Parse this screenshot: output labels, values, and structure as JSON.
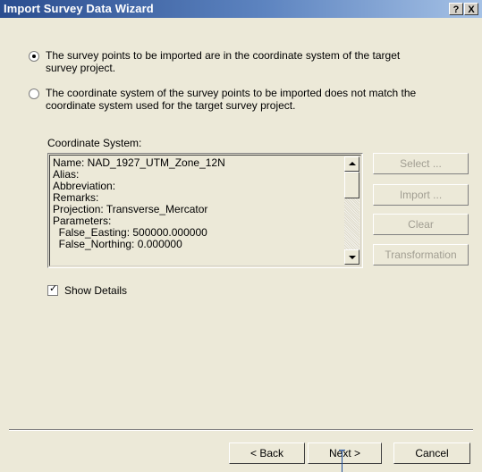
{
  "window": {
    "title": "Import Survey Data Wizard",
    "help_label": "?",
    "close_label": "X"
  },
  "options": {
    "same_system": {
      "line1": "The survey points to be imported are in the coordinate system of the target",
      "line2": "survey project.",
      "checked": true
    },
    "different_system": {
      "line1": "The coordinate system of the survey points to be imported does not match the",
      "line2": "coordinate system used for the target survey project.",
      "checked": false
    }
  },
  "coordinate_system": {
    "label": "Coordinate System:",
    "lines": [
      "Name: NAD_1927_UTM_Zone_12N",
      "Alias:",
      "Abbreviation:",
      "Remarks:",
      "Projection: Transverse_Mercator",
      "Parameters:",
      "  False_Easting: 500000.000000",
      "  False_Northing: 0.000000"
    ]
  },
  "side_buttons": {
    "select": "Select ...",
    "import": "Import ...",
    "clear": "Clear",
    "transformation": "Transformation"
  },
  "show_details": {
    "label": "Show Details",
    "checked": true
  },
  "footer": {
    "back": "< Back",
    "next": "Next >",
    "cancel": "Cancel"
  }
}
